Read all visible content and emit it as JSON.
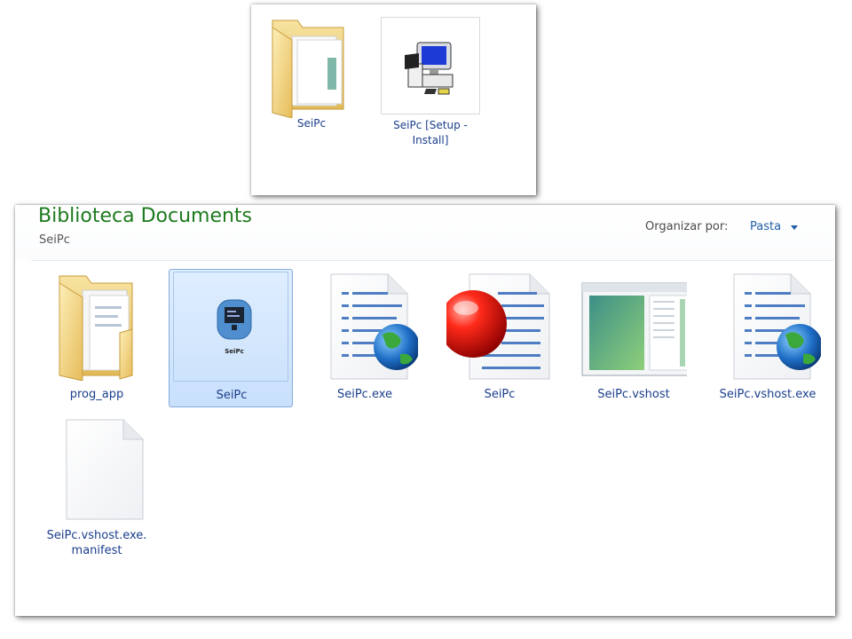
{
  "top_panel": {
    "items": [
      {
        "label": "SeiPc",
        "icon": "folder-icon"
      },
      {
        "label": "SeiPc  [Setup -\nInstall]",
        "icon": "setup-install-icon"
      }
    ]
  },
  "main_panel": {
    "library_title": "Biblioteca Documents",
    "subfolder": "SeiPc",
    "arrange": {
      "label": "Organizar por:",
      "value": "Pasta"
    },
    "files": [
      {
        "label": "prog_app",
        "icon": "folder-icon"
      },
      {
        "label": "SeiPc",
        "icon": "app-icon",
        "selected": true,
        "icon_caption": "SeiPc"
      },
      {
        "label": "SeiPc.exe",
        "icon": "exe-document-globe-icon"
      },
      {
        "label": "SeiPc",
        "icon": "red-ball-document-icon"
      },
      {
        "label": "SeiPc.vshost",
        "icon": "window-app-icon"
      },
      {
        "label": "SeiPc.vshost.exe",
        "icon": "exe-document-globe-icon"
      },
      {
        "label": "SeiPc.vshost.exe.\nmanifest",
        "icon": "blank-document-icon"
      }
    ]
  },
  "colors": {
    "library_title": "#1e7a1e",
    "link": "#1a3e8c",
    "selection": "#cce4ff"
  }
}
